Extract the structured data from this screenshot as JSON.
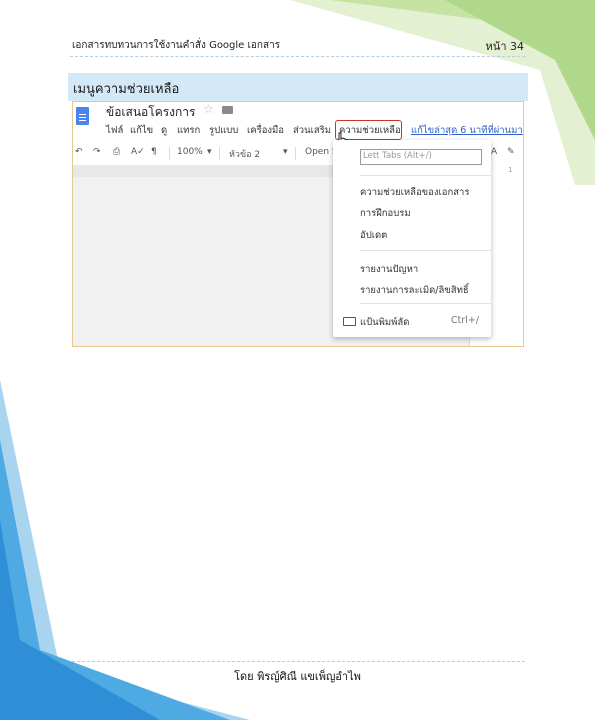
{
  "header": {
    "left_text": "เอกสารทบทวนการใช้งานคำสั่ง Google เอกสาร",
    "page_label": "หน้า 34"
  },
  "section": {
    "title": "เมนูความช่วยเหลือ"
  },
  "screenshot": {
    "doc_title": "ข้อเสนอโครงการ",
    "menu": [
      "ไฟล์",
      "แก้ไข",
      "ดู",
      "แทรก",
      "รูปแบบ",
      "เครื่องมือ",
      "ส่วนเสริม"
    ],
    "help_menu_label": "ความช่วยเหลือ",
    "last_edit": "แก้ไขล่าสุด 6 นาทีที่ผ่านมา",
    "toolbar": {
      "zoom": "100%",
      "style": "หัวข้อ 2",
      "font": "Open S"
    },
    "ruler_num": "1",
    "help_dropdown": {
      "search_placeholder": "Lett Tabs (Alt+/)",
      "items": [
        "ความช่วยเหลือของเอกสาร",
        "การฝึกอบรม",
        "อัปเดต",
        "รายงานปัญหา",
        "รายงานการละเมิด/ลิขสิทธิ์"
      ],
      "shortcuts_label": "แป้นพิมพ์ลัด",
      "shortcuts_key": "Ctrl+/"
    }
  },
  "footer": {
    "author": "โดย พิรญ์ศิณี แขเพ็ญอำไพ"
  },
  "colors": {
    "section_bar": "#d4e9f7",
    "decor_green": "#c9e4a6",
    "decor_blue": "#3fa0e0",
    "highlight_red": "#d0302a",
    "link_blue": "#3062c8"
  }
}
